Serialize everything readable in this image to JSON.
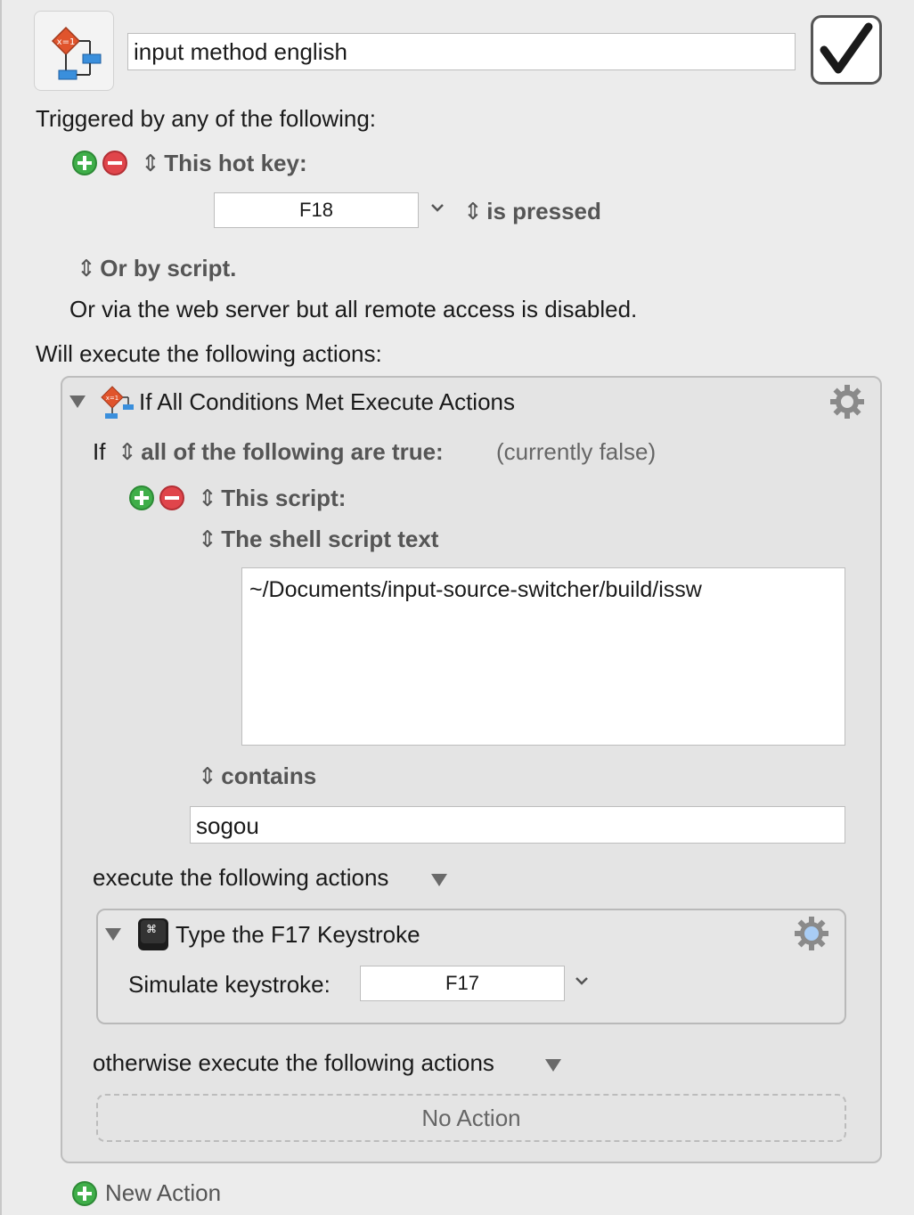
{
  "macro": {
    "name": "input method english"
  },
  "triggers": {
    "heading": "Triggered by any of the following:",
    "hotkey_label": "This hot key:",
    "hotkey_value": "F18",
    "hotkey_mode": "is pressed",
    "or_script": "Or by script.",
    "web_server_note": "Or via the web server but all remote access is disabled."
  },
  "actions": {
    "heading": "Will execute the following actions:",
    "if_action": {
      "title": "If All Conditions Met Execute Actions",
      "if_label": "If",
      "condition_mode": "all of the following are true:",
      "status": "(currently false)",
      "condition_type": "This script:",
      "script_kind": "The shell script text",
      "script_text": "~/Documents/input-source-switcher/build/issw",
      "match_mode": "contains",
      "match_value": "sogou",
      "then_label": "execute the following actions",
      "then_action": {
        "title": "Type the F17 Keystroke",
        "simulate_label": "Simulate keystroke:",
        "keystroke": "F17"
      },
      "else_label": "otherwise execute the following actions",
      "else_placeholder": "No Action"
    },
    "new_action": "New Action"
  },
  "colors": {
    "add_green": "#3fae49",
    "remove_red": "#e0454b",
    "background": "#ececec"
  }
}
